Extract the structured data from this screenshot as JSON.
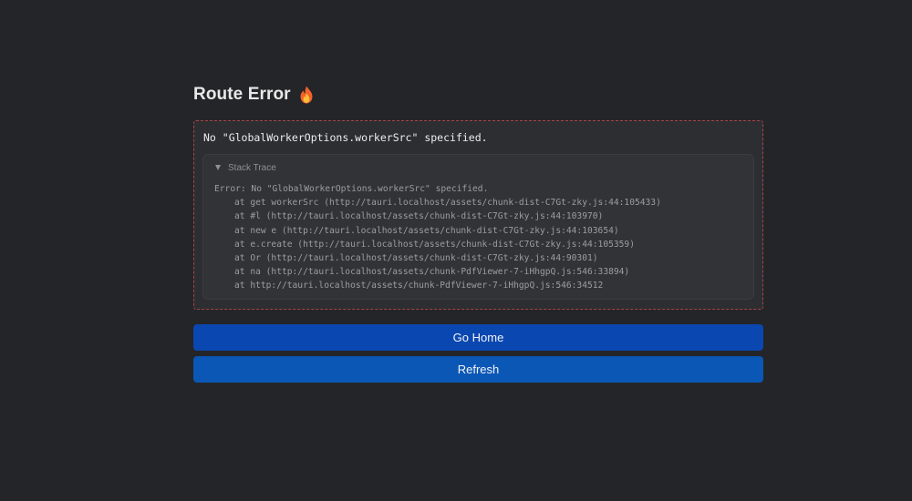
{
  "header": {
    "title": "Route Error",
    "icon": "fire-icon"
  },
  "error": {
    "message": "No \"GlobalWorkerOptions.workerSrc\" specified."
  },
  "stack_trace": {
    "summary_label": "Stack Trace",
    "expanded": true,
    "first_line": "Error: No \"GlobalWorkerOptions.workerSrc\" specified.",
    "frames": [
      "at get workerSrc (http://tauri.localhost/assets/chunk-dist-C7Gt-zky.js:44:105433)",
      "at #l (http://tauri.localhost/assets/chunk-dist-C7Gt-zky.js:44:103970)",
      "at new e (http://tauri.localhost/assets/chunk-dist-C7Gt-zky.js:44:103654)",
      "at e.create (http://tauri.localhost/assets/chunk-dist-C7Gt-zky.js:44:105359)",
      "at Or (http://tauri.localhost/assets/chunk-dist-C7Gt-zky.js:44:90301)",
      "at na (http://tauri.localhost/assets/chunk-PdfViewer-7-iHhgpQ.js:546:33894)",
      "at http://tauri.localhost/assets/chunk-PdfViewer-7-iHhgpQ.js:546:34512"
    ]
  },
  "actions": {
    "home_label": "Go Home",
    "refresh_label": "Refresh"
  },
  "colors": {
    "background": "#242528",
    "error_border": "#a8434a",
    "home_button": "#0b47b0",
    "refresh_button": "#0b57b6"
  }
}
